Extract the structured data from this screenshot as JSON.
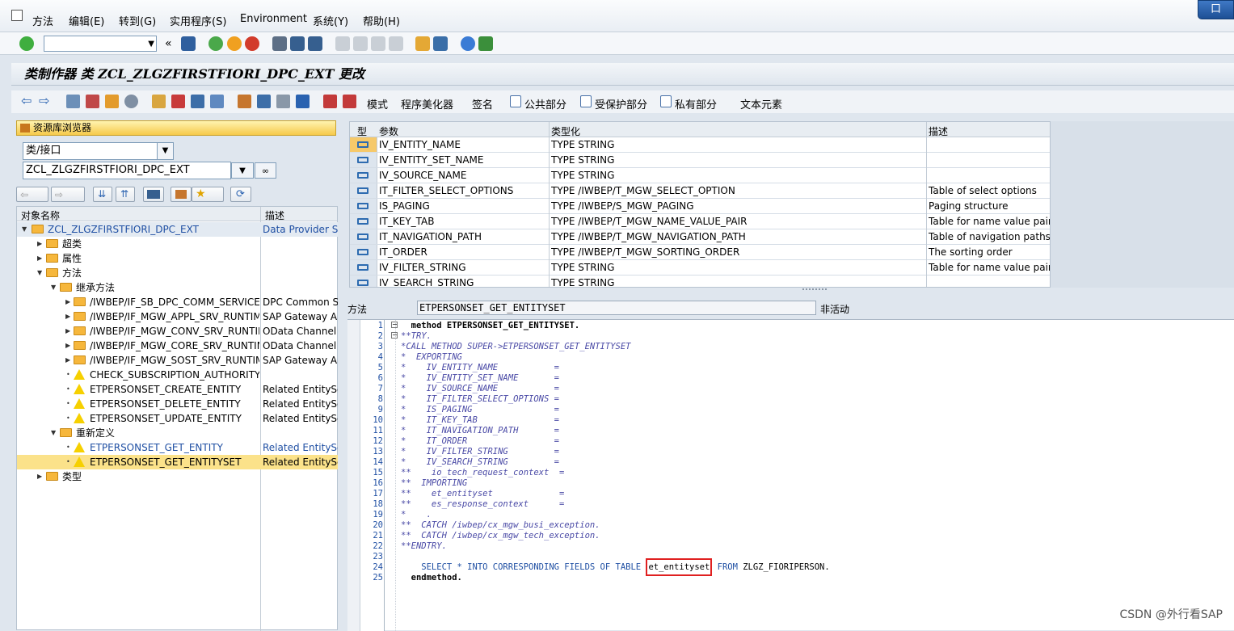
{
  "menubar": {
    "items": [
      "方法",
      "编辑(E)",
      "转到(G)",
      "实用程序(S)",
      "Environment",
      "系统(Y)",
      "帮助(H)"
    ],
    "window_button": "口"
  },
  "title": "类制作器 类 ZCL_ZLGZFIRSTFIORI_DPC_EXT 更改",
  "appbar": {
    "buttons": [
      "模式",
      "程序美化器",
      "签名",
      "公共部分",
      "受保护部分",
      "私有部分",
      "文本元素"
    ]
  },
  "browser": {
    "tab_label": "资源库浏览器",
    "type_select": "类/接口",
    "object_input": "ZCL_ZLGZFIRSTFIORI_DPC_EXT",
    "col_name": "对象名称",
    "col_desc": "描述",
    "rows": [
      {
        "name": "ZCL_ZLGZFIRSTFIORI_DPC_EXT",
        "desc": "Data Provider Sec"
      },
      {
        "name": "超类",
        "desc": ""
      },
      {
        "name": "属性",
        "desc": ""
      },
      {
        "name": "方法",
        "desc": ""
      },
      {
        "name": "继承方法",
        "desc": ""
      },
      {
        "name": "/IWBEP/IF_SB_DPC_COMM_SERVICES",
        "desc": "DPC Common Ser"
      },
      {
        "name": "/IWBEP/IF_MGW_APPL_SRV_RUNTIME",
        "desc": "SAP Gateway Ap"
      },
      {
        "name": "/IWBEP/IF_MGW_CONV_SRV_RUNTIME",
        "desc": "OData Channel - "
      },
      {
        "name": "/IWBEP/IF_MGW_CORE_SRV_RUNTIME",
        "desc": "OData Channel - "
      },
      {
        "name": "/IWBEP/IF_MGW_SOST_SRV_RUNTIME",
        "desc": "SAP Gateway Ap"
      },
      {
        "name": "CHECK_SUBSCRIPTION_AUTHORITY",
        "desc": ""
      },
      {
        "name": "ETPERSONSET_CREATE_ENTITY",
        "desc": "Related EntitySet"
      },
      {
        "name": "ETPERSONSET_DELETE_ENTITY",
        "desc": "Related EntitySet"
      },
      {
        "name": "ETPERSONSET_UPDATE_ENTITY",
        "desc": "Related EntitySet"
      },
      {
        "name": "重新定义",
        "desc": ""
      },
      {
        "name": "ETPERSONSET_GET_ENTITY",
        "desc": "Related EntitySet"
      },
      {
        "name": "ETPERSONSET_GET_ENTITYSET",
        "desc": "Related EntitySet"
      },
      {
        "name": "类型",
        "desc": ""
      }
    ]
  },
  "params": {
    "headers": [
      "型",
      "参数",
      "类型化",
      "描述"
    ],
    "rows": [
      {
        "param": "IV_ENTITY_NAME",
        "type": "TYPE STRING",
        "desc": ""
      },
      {
        "param": "IV_ENTITY_SET_NAME",
        "type": "TYPE STRING",
        "desc": ""
      },
      {
        "param": "IV_SOURCE_NAME",
        "type": "TYPE STRING",
        "desc": ""
      },
      {
        "param": "IT_FILTER_SELECT_OPTIONS",
        "type": "TYPE /IWBEP/T_MGW_SELECT_OPTION",
        "desc": "Table of select options"
      },
      {
        "param": "IS_PAGING",
        "type": "TYPE /IWBEP/S_MGW_PAGING",
        "desc": "Paging structure"
      },
      {
        "param": "IT_KEY_TAB",
        "type": "TYPE /IWBEP/T_MGW_NAME_VALUE_PAIR",
        "desc": "Table for name value pairs"
      },
      {
        "param": "IT_NAVIGATION_PATH",
        "type": "TYPE /IWBEP/T_MGW_NAVIGATION_PATH",
        "desc": "Table of navigation paths"
      },
      {
        "param": "IT_ORDER",
        "type": "TYPE /IWBEP/T_MGW_SORTING_ORDER",
        "desc": "The sorting order"
      },
      {
        "param": "IV_FILTER_STRING",
        "type": "TYPE STRING",
        "desc": "Table for name value pairs"
      },
      {
        "param": "IV_SEARCH_STRING",
        "type": "TYPE STRING",
        "desc": ""
      }
    ]
  },
  "method": {
    "label": "方法",
    "name": "ETPERSONSET_GET_ENTITYSET",
    "status": "非活动"
  },
  "code": [
    {
      "n": "1",
      "text": "  method ETPERSONSET_GET_ENTITYSET."
    },
    {
      "n": "2",
      "text": "**TRY."
    },
    {
      "n": "3",
      "text": "*CALL METHOD SUPER->ETPERSONSET_GET_ENTITYSET"
    },
    {
      "n": "4",
      "text": "*  EXPORTING"
    },
    {
      "n": "5",
      "text": "*    IV_ENTITY_NAME           ="
    },
    {
      "n": "6",
      "text": "*    IV_ENTITY_SET_NAME       ="
    },
    {
      "n": "7",
      "text": "*    IV_SOURCE_NAME           ="
    },
    {
      "n": "8",
      "text": "*    IT_FILTER_SELECT_OPTIONS ="
    },
    {
      "n": "9",
      "text": "*    IS_PAGING                ="
    },
    {
      "n": "10",
      "text": "*    IT_KEY_TAB               ="
    },
    {
      "n": "11",
      "text": "*    IT_NAVIGATION_PATH       ="
    },
    {
      "n": "12",
      "text": "*    IT_ORDER                 ="
    },
    {
      "n": "13",
      "text": "*    IV_FILTER_STRING         ="
    },
    {
      "n": "14",
      "text": "*    IV_SEARCH_STRING         ="
    },
    {
      "n": "15",
      "text": "**    io_tech_request_context  ="
    },
    {
      "n": "16",
      "text": "**  IMPORTING"
    },
    {
      "n": "17",
      "text": "**    et_entityset             ="
    },
    {
      "n": "18",
      "text": "**    es_response_context      ="
    },
    {
      "n": "19",
      "text": "*    ."
    },
    {
      "n": "20",
      "text": "**  CATCH /iwbep/cx_mgw_busi_exception."
    },
    {
      "n": "21",
      "text": "**  CATCH /iwbep/cx_mgw_tech_exception."
    },
    {
      "n": "22",
      "text": "**ENDTRY."
    },
    {
      "n": "23",
      "text": ""
    },
    {
      "n": "24",
      "text": ""
    },
    {
      "n": "25",
      "text": "  endmethod."
    }
  ],
  "code_line24": {
    "prefix": "    SELECT * INTO CORRESPONDING FIELDS OF TABLE ",
    "highlight": "et_entityset",
    "suffix_kw": " FROM",
    "suffix": " ZLGZ_FIORIPERSON."
  },
  "watermark": "CSDN @外行看SAP"
}
